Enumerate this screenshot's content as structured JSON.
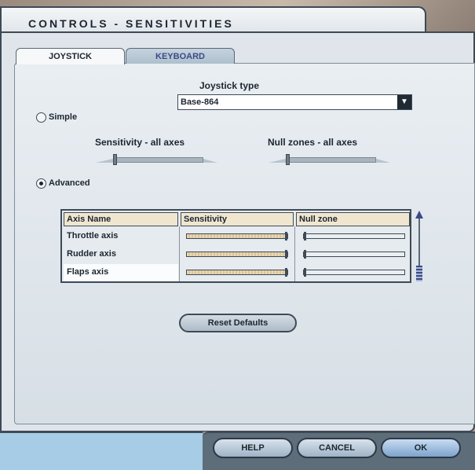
{
  "window": {
    "title": "CONTROLS - SENSITIVITIES"
  },
  "tabs": [
    {
      "label": "JOYSTICK",
      "active": true
    },
    {
      "label": "KEYBOARD",
      "active": false
    }
  ],
  "joystick_type": {
    "label": "Joystick type",
    "value": "Base-864"
  },
  "modes": [
    {
      "label": "Simple",
      "selected": false
    },
    {
      "label": "Advanced",
      "selected": true
    }
  ],
  "simple": {
    "sensitivity_label": "Sensitivity - all axes",
    "null_zone_label": "Null zones - all axes",
    "sensitivity_level": 0.0,
    "null_zone_level": 0.0
  },
  "table": {
    "headers": [
      "Axis Name",
      "Sensitivity",
      "Null zone"
    ],
    "rows": [
      {
        "axis": "Throttle axis",
        "sensitivity": 1.0,
        "null_zone": 0.0
      },
      {
        "axis": "Rudder axis",
        "sensitivity": 1.0,
        "null_zone": 0.0
      },
      {
        "axis": "Flaps axis",
        "sensitivity": 1.0,
        "null_zone": 0.0,
        "selected": true
      }
    ]
  },
  "buttons": {
    "reset_defaults": "Reset Defaults",
    "help": "HELP",
    "cancel": "CANCEL",
    "ok": "OK"
  },
  "colors": {
    "accent": "#3b4a86",
    "header_fill": "#f0e6d0",
    "sensitivity_fill": "#ead7b3"
  }
}
